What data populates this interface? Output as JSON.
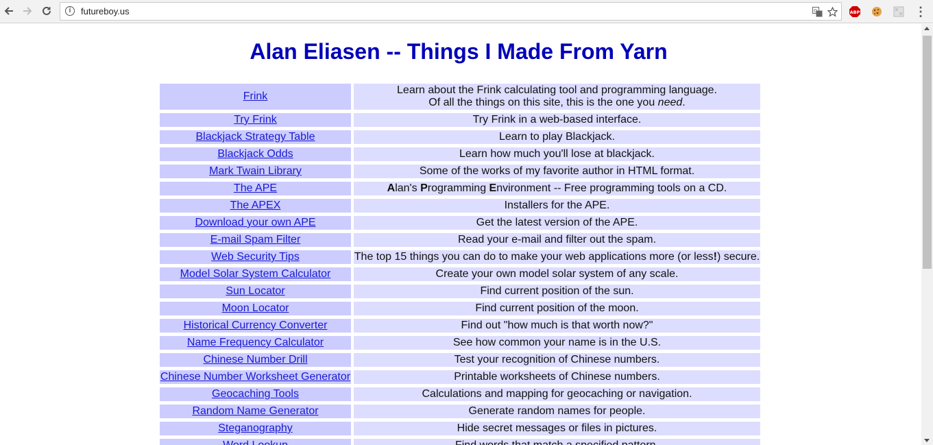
{
  "browser": {
    "url": "futureboy.us",
    "icons": {
      "back": "arrow-left-icon",
      "forward": "arrow-right-icon",
      "reload": "reload-icon",
      "info": "info-icon",
      "translate": "translate-icon",
      "bookmark": "star-icon",
      "adblock": "abp-icon",
      "cookie": "cookie-icon",
      "extension": "extension-icon",
      "menu": "kebab-menu-icon"
    },
    "adblock_label": "ABP",
    "menu_glyph": "⋮"
  },
  "page": {
    "title": "Alan Eliasen -- Things I Made From Yarn",
    "rows": [
      {
        "link": "Frink",
        "desc_line1": "Learn about the Frink calculating tool and programming language.",
        "desc_line2_pre": "Of all the things on this site, this is the one you ",
        "desc_line2_em": "need",
        "desc_line2_post": "."
      },
      {
        "link": "Try Frink",
        "desc": "Try Frink in a web-based interface."
      },
      {
        "link": "Blackjack Strategy Table",
        "desc": "Learn to play Blackjack."
      },
      {
        "link": "Blackjack Odds",
        "desc": "Learn how much you'll lose at blackjack."
      },
      {
        "link": "Mark Twain Library",
        "desc": "Some of the works of my favorite author in HTML format."
      },
      {
        "link": "The APE",
        "ape_A": "A",
        "ape_lan": "lan's ",
        "ape_P": "P",
        "ape_rog": "rogramming ",
        "ape_E": "E",
        "ape_rest": "nvironment -- Free programming tools on a CD."
      },
      {
        "link": "The APEX",
        "desc": "Installers for the APE."
      },
      {
        "link": "Download your own APE",
        "desc": "Get the latest version of the APE."
      },
      {
        "link": "E-mail Spam Filter",
        "desc": "Read your e-mail and filter out the spam."
      },
      {
        "link": "Web Security Tips",
        "sec_pre": "The top 15 things you can do to make your web applications more (or less",
        "sec_bang": "!",
        "sec_post": ") secure."
      },
      {
        "link": "Model Solar System Calculator",
        "desc": "Create your own model solar system of any scale."
      },
      {
        "link": "Sun Locator",
        "desc": "Find current position of the sun."
      },
      {
        "link": "Moon Locator",
        "desc": "Find current position of the moon."
      },
      {
        "link": "Historical Currency Converter",
        "desc": "Find out \"how much is that worth now?\""
      },
      {
        "link": "Name Frequency Calculator",
        "desc": "See how common your name is in the U.S."
      },
      {
        "link": "Chinese Number Drill",
        "desc": "Test your recognition of Chinese numbers."
      },
      {
        "link": "Chinese Number Worksheet Generator",
        "desc": "Printable worksheets of Chinese numbers."
      },
      {
        "link": "Geocaching Tools",
        "desc": "Calculations and mapping for geocaching or navigation."
      },
      {
        "link": "Random Name Generator",
        "desc": "Generate random names for people."
      },
      {
        "link": "Steganography",
        "desc": "Hide secret messages or files in pictures."
      },
      {
        "link": "Word Lookup",
        "desc": "Find words that match a specified pattern."
      }
    ]
  }
}
